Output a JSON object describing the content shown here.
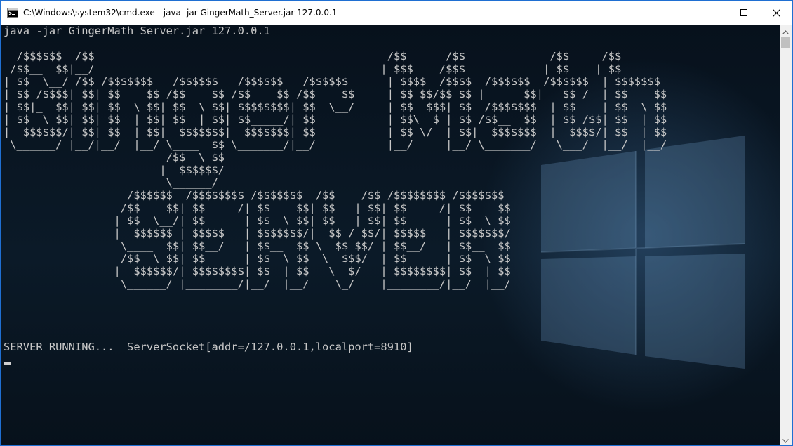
{
  "window": {
    "title": "C:\\Windows\\system32\\cmd.exe - java  -jar GingerMath_Server.jar 127.0.0.1",
    "icon": "cmd-icon"
  },
  "titlebar_controls": {
    "minimize": "minimize-icon",
    "maximize": "maximize-icon",
    "close": "close-icon"
  },
  "console": {
    "command_line": "java -jar GingerMath_Server.jar 127.0.0.1",
    "banner": "\n  /$$$$$$  /$$                                             /$$      /$$             /$$     /$$\n /$$__  $$|__/                                            | $$$    /$$$            | $$    | $$\n| $$  \\__/ /$$ /$$$$$$$   /$$$$$$   /$$$$$$   /$$$$$$      | $$$$  /$$$$  /$$$$$$  /$$$$$$  | $$$$$$$\n| $$ /$$$$| $$| $$__  $$ /$$__  $$ /$$__  $$ /$$__  $$     | $$ $$/$$ $$ |____  $$|_  $$_/  | $$__  $$\n| $$|_  $$| $$| $$  \\ $$| $$  \\ $$| $$$$$$$$| $$  \\__/     | $$  $$$| $$  /$$$$$$$  | $$    | $$  \\ $$\n| $$  \\ $$| $$| $$  | $$| $$  | $$| $$_____/| $$           | $$\\  $ | $$ /$$__  $$  | $$ /$$| $$  | $$\n|  $$$$$$/| $$| $$  | $$|  $$$$$$$|  $$$$$$$| $$           | $$ \\/  | $$|  $$$$$$$  |  $$$$/| $$  | $$\n \\______/ |__/|__/  |__/ \\____  $$ \\_______/|__/           |__/     |__/ \\_______/   \\___/  |__/  |__/\n                         /$$  \\ $$\n                        |  $$$$$$/\n                         \\______/\n                   /$$$$$$  /$$$$$$$$ /$$$$$$$  /$$    /$$ /$$$$$$$$ /$$$$$$$\n                  /$$__  $$| $$_____/| $$__  $$| $$   | $$| $$_____/| $$__  $$\n                 | $$  \\__/| $$      | $$  \\ $$| $$   | $$| $$      | $$  \\ $$\n                 |  $$$$$$ | $$$$$   | $$$$$$$/|  $$ / $$/| $$$$$   | $$$$$$$/\n                  \\____  $$| $$__/   | $$__  $$ \\  $$ $$/ | $$__/   | $$__  $$\n                  /$$  \\ $$| $$      | $$  \\ $$  \\  $$$/  | $$      | $$  \\ $$\n                 |  $$$$$$/| $$$$$$$$| $$  | $$   \\  $/   | $$$$$$$$| $$  | $$\n                  \\______/ |________/|__/  |__/    \\_/    |________/|__/  |__/",
    "status_line": "SERVER RUNNING...  ServerSocket[addr=/127.0.0.1,localport=8910]"
  },
  "scrollbar": {
    "up": "scroll-up-arrow-icon",
    "down": "scroll-down-arrow-icon"
  },
  "colors": {
    "console_text": "#c7c7c7",
    "window_border": "#1f6fd2",
    "titlebar_bg": "#ffffff"
  }
}
